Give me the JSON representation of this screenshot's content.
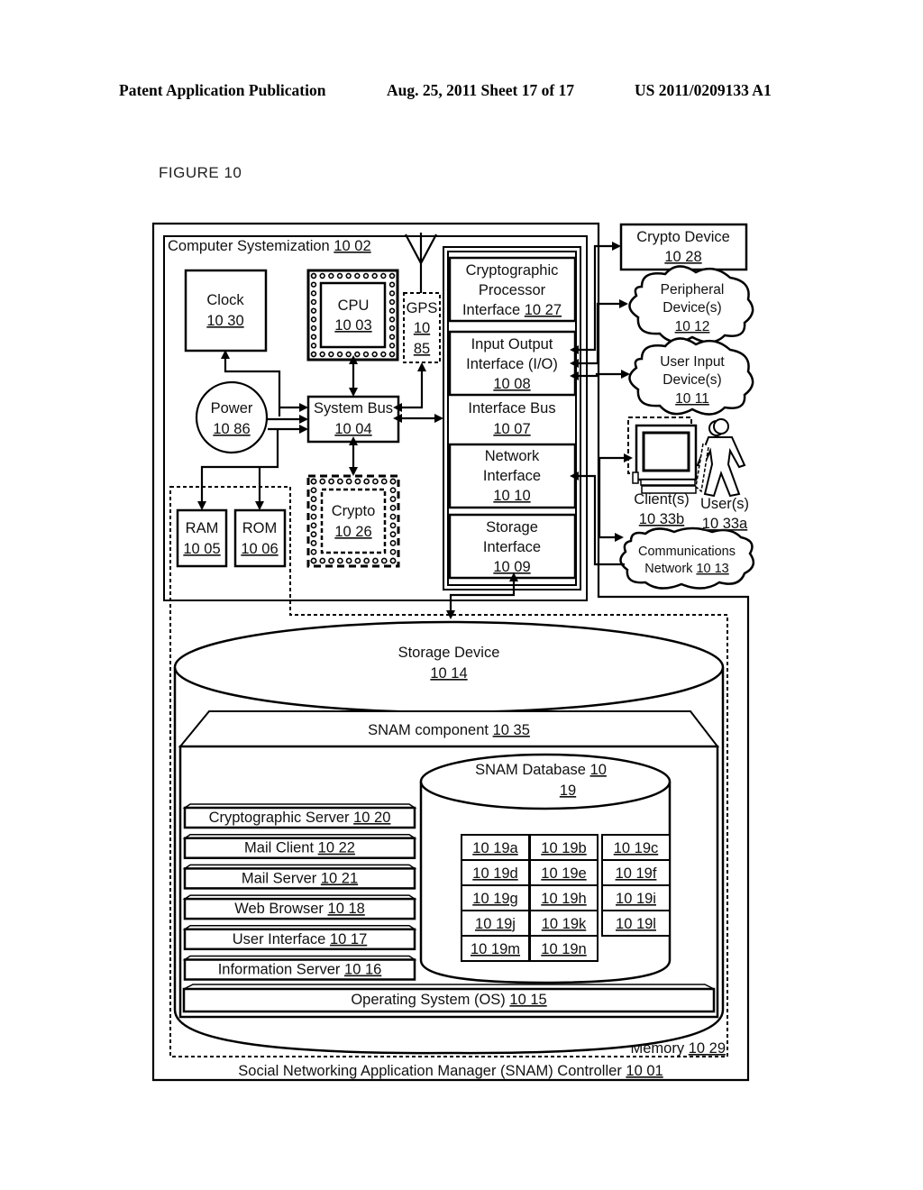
{
  "header": {
    "publication": "Patent Application Publication",
    "date_sheet": "Aug. 25, 2011  Sheet 17 of 17",
    "patent_number": "US 2011/0209133 A1"
  },
  "figure_label": "FIGURE 10",
  "controller": {
    "label": "Social Networking Application Manager (SNAM) Controller",
    "ref": "10 01"
  },
  "computer_systemization": {
    "label": "Computer Systemization",
    "ref": "10 02"
  },
  "clock": {
    "label": "Clock",
    "ref": "10 30"
  },
  "cpu": {
    "label": "CPU",
    "ref": "10 03"
  },
  "gps": {
    "label": "GPS",
    "ref_line1": "10",
    "ref_line2": "85"
  },
  "power": {
    "label": "Power",
    "ref": "10 86"
  },
  "system_bus": {
    "label": "System Bus",
    "ref": "10 04"
  },
  "crypto": {
    "label": "Crypto",
    "ref": "10 26"
  },
  "ram": {
    "label": "RAM",
    "ref": "10 05"
  },
  "rom": {
    "label": "ROM",
    "ref": "10 06"
  },
  "crypto_processor_interface": {
    "line1": "Cryptographic",
    "line2": "Processor",
    "line3": "Interface",
    "ref": "10 27"
  },
  "io_interface": {
    "line1": "Input Output",
    "line2": "Interface (I/O)",
    "ref": "10 08"
  },
  "interface_bus": {
    "label": "Interface Bus",
    "ref": "10 07"
  },
  "network_interface": {
    "line1": "Network",
    "line2": "Interface",
    "ref": "10 10"
  },
  "storage_interface": {
    "line1": "Storage",
    "line2": "Interface",
    "ref": "10 09"
  },
  "crypto_device": {
    "label": "Crypto Device",
    "ref": "10 28"
  },
  "peripheral_devices": {
    "line1": "Peripheral",
    "line2": "Device(s)",
    "ref": "10 12"
  },
  "user_input_devices": {
    "line1": "User Input",
    "line2": "Device(s)",
    "ref": "10 11"
  },
  "clients": {
    "label": "Client(s)",
    "ref": "10 33b"
  },
  "users": {
    "label": "User(s)",
    "ref": "10 33a"
  },
  "communications_network": {
    "line1": "Communications",
    "line2": "Network",
    "ref": "10 13"
  },
  "storage_device": {
    "label": "Storage Device",
    "ref": "10 14"
  },
  "snam_component": {
    "label": "SNAM component",
    "ref": "10 35"
  },
  "snam_database": {
    "label": "SNAM Database",
    "ref_line1": "10",
    "ref_line2": "19"
  },
  "components": [
    {
      "label": "Cryptographic Server",
      "ref": "10 20"
    },
    {
      "label": "Mail Client",
      "ref": "10 22"
    },
    {
      "label": "Mail Server",
      "ref": "10 21"
    },
    {
      "label": "Web Browser",
      "ref": "10 18"
    },
    {
      "label": "User Interface",
      "ref": "10 17"
    },
    {
      "label": "Information Server",
      "ref": "10 16"
    }
  ],
  "operating_system": {
    "label": "Operating System (OS)",
    "ref": "10 15"
  },
  "memory": {
    "label": "Memory",
    "ref": "10 29"
  },
  "db_tables": [
    [
      "10 19a",
      "10 19b",
      "10 19c"
    ],
    [
      "10 19d",
      "10 19e",
      "10 19f"
    ],
    [
      "10 19g",
      "10 19h",
      "10 19i"
    ],
    [
      "10 19j",
      "10 19k",
      "10 19l"
    ],
    [
      "10 19m",
      "10 19n"
    ]
  ]
}
